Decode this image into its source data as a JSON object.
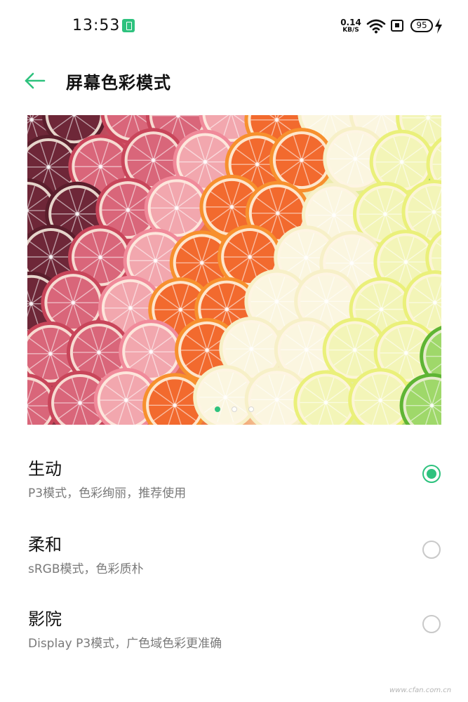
{
  "status_bar": {
    "time": "13:53",
    "net_speed_value": "0.14",
    "net_speed_unit": "KB/S",
    "battery_level": "95",
    "icons": [
      "battery-saver-icon",
      "wifi-icon",
      "sim-icon",
      "battery-icon",
      "charging-icon"
    ]
  },
  "header": {
    "back_icon": "back-arrow-icon",
    "title": "屏幕色彩模式"
  },
  "preview": {
    "image": "citrus-slices-photo",
    "pages": 3,
    "active_page": 1
  },
  "options": [
    {
      "title": "生动",
      "description": "P3模式，色彩绚丽，推荐使用",
      "selected": true
    },
    {
      "title": "柔和",
      "description": "sRGB模式，色彩质朴",
      "selected": false
    },
    {
      "title": "影院",
      "description": "Display P3模式，广色域色彩更准确",
      "selected": false
    }
  ],
  "watermark": "www.cfan.com.cn",
  "colors": {
    "accent": "#2ec27e",
    "text_primary": "#111111",
    "text_secondary": "#7a7a7a",
    "radio_border": "#c9c9c9"
  }
}
